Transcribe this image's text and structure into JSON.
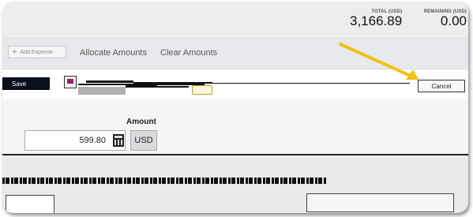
{
  "header": {
    "total_label": "TOTAL (USD)",
    "total_value": "3,166.89",
    "remaining_label": "REMAINING (USD)",
    "remaining_value": "0.00"
  },
  "toolbar": {
    "add_expense_label": "Add Expense",
    "allocate_label": "Allocate Amounts",
    "clear_label": "Clear Amounts"
  },
  "allocation_bar": {
    "save_label": "Save",
    "cancel_label": "Cancel"
  },
  "amount": {
    "label": "Amount",
    "value": "599.80",
    "currency": "USD"
  },
  "icons": {
    "plus": "plus-icon",
    "calculator": "calculator-icon",
    "gl": "gl-account-icon"
  },
  "colors": {
    "arrow": "#f2c10f",
    "save_bg": "#0a0f1e",
    "gl_accent": "#9b1d5e"
  }
}
